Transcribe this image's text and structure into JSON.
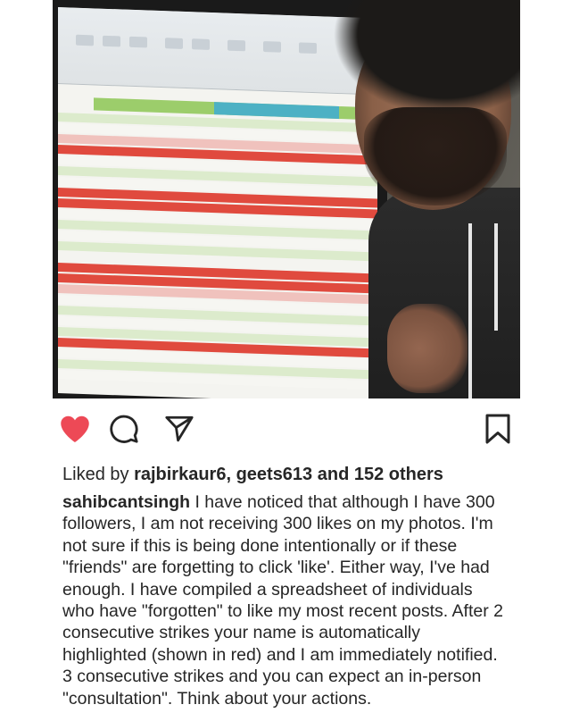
{
  "post": {
    "liked_by_prefix": "Liked by",
    "liked_by_users": "rajbirkaur6, geets613",
    "liked_by_suffix": "and 152 others",
    "caption_user": "sahibcantsingh",
    "caption_text": "I have noticed that although I have 300 followers, I am not receiving 300 likes on my photos. I'm not sure if this is being done intentionally or if these \"friends\" are forgetting to click 'like'. Either way, I've had enough. I have compiled a spreadsheet of individuals who have \"forgotten\" to like my most recent posts. After 2 consecutive strikes your name is automatically highlighted (shown in red) and I am immediately notified. 3 consecutive strikes and you can expect an in-person \"consultation\". Think about your actions."
  },
  "icons": {
    "like": "heart-icon",
    "comment": "comment-icon",
    "share": "paper-plane-icon",
    "save": "bookmark-icon"
  },
  "colors": {
    "liked_heart": "#ed4956",
    "icon_stroke": "#262626",
    "text": "#262626"
  }
}
